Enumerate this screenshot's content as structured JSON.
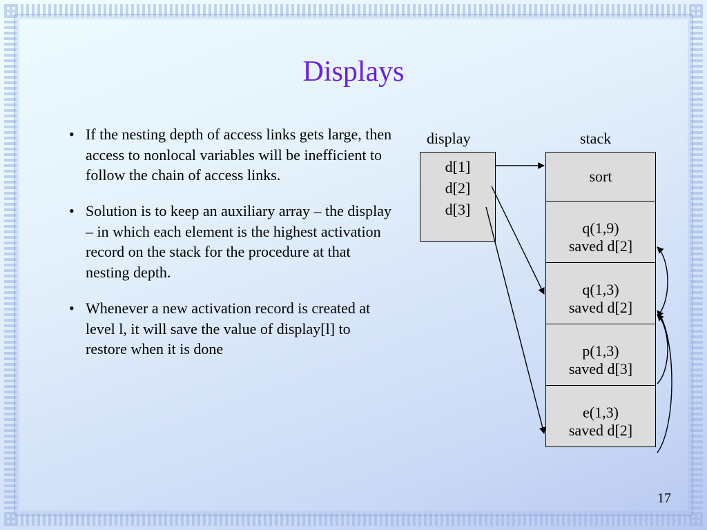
{
  "title": "Displays",
  "bullets": [
    "If the nesting depth of access links gets large, then access to nonlocal variables will be inefficient to follow the chain of access links.",
    "Solution is to keep an auxiliary array – the display – in which each element is the highest activation record on the stack for the procedure at that nesting depth.",
    "Whenever a new activation record is created at level l, it will save the value of display[l] to restore when it is done"
  ],
  "diagram": {
    "display_label": "display",
    "stack_label": "stack",
    "display_entries": [
      "d[1]",
      "d[2]",
      "d[3]"
    ],
    "stack": [
      {
        "main": "sort",
        "saved": ""
      },
      {
        "main": "q(1,9)",
        "saved": "saved d[2]"
      },
      {
        "main": "q(1,3)",
        "saved": "saved d[2]"
      },
      {
        "main": "p(1,3)",
        "saved": "saved d[3]"
      },
      {
        "main": "e(1,3)",
        "saved": "saved d[2]"
      }
    ]
  },
  "page_number": "17"
}
